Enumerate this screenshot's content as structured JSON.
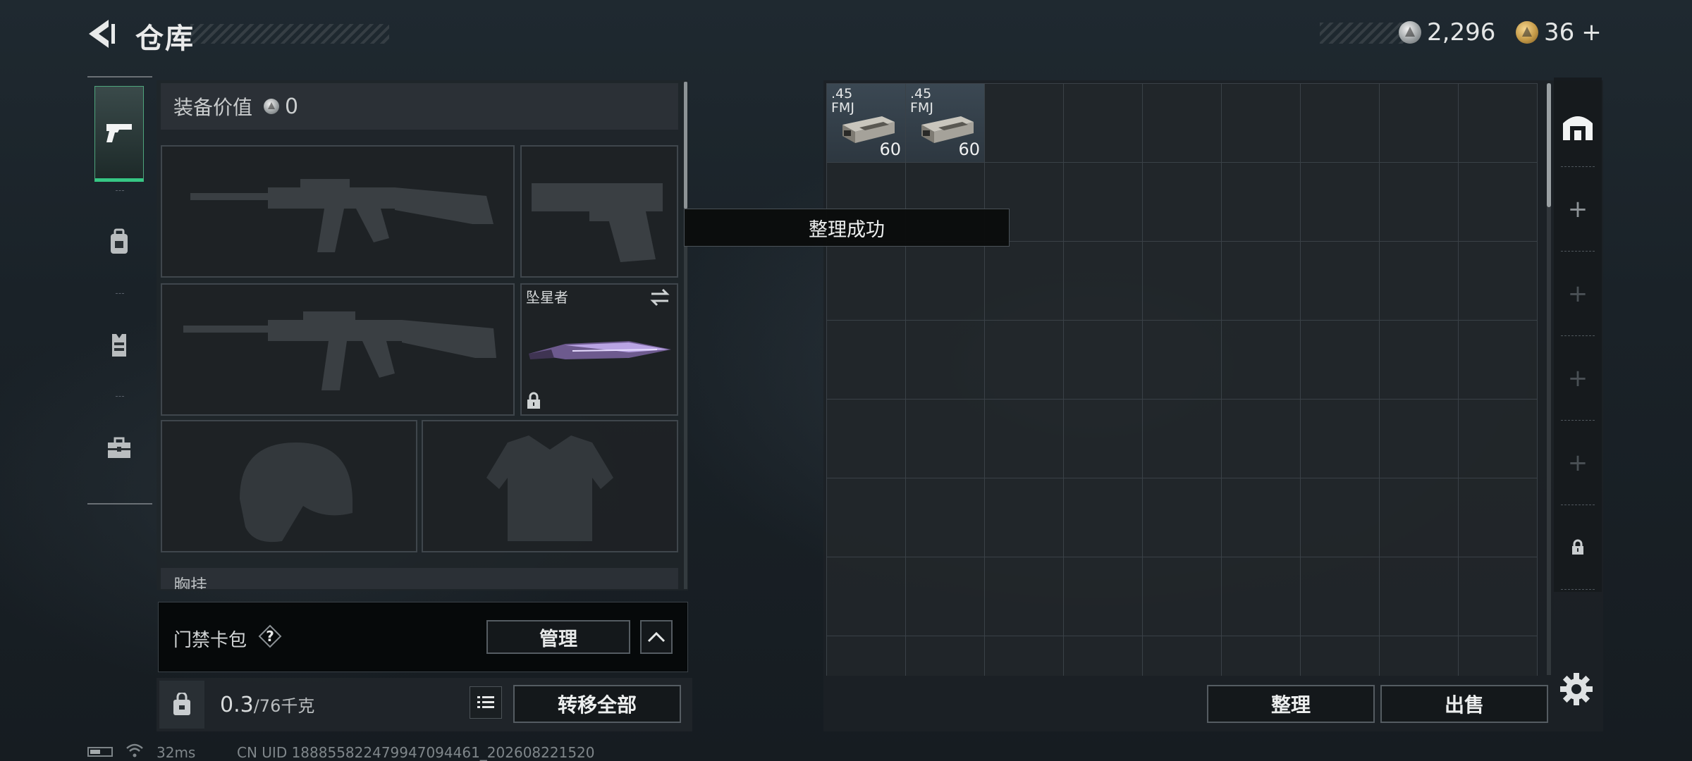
{
  "header": {
    "title": "仓库",
    "silver_amount": "2,296",
    "gold_amount": "36",
    "gold_plus": "+"
  },
  "rail": {
    "items": [
      {
        "icon": "pistol-icon",
        "active": true
      },
      {
        "icon": "backpack-icon",
        "active": false
      },
      {
        "icon": "chest-rig-icon",
        "active": false
      },
      {
        "icon": "toolbox-icon",
        "active": false
      }
    ]
  },
  "equipment": {
    "value_label": "装备价值",
    "value_amount": "0",
    "melee_name": "坠星者",
    "chest_rig_label": "胸挂"
  },
  "keycard": {
    "label": "门禁卡包",
    "manage_label": "管理"
  },
  "weight": {
    "current": "0.3",
    "capacity": "/76千克"
  },
  "buttons": {
    "transfer_all": "转移全部",
    "sort": "整理",
    "sell": "出售"
  },
  "toast": {
    "message": "整理成功"
  },
  "storage": {
    "items": [
      {
        "label_line1": ".45",
        "label_line2": "FMJ",
        "count": "60"
      },
      {
        "label_line1": ".45",
        "label_line2": "FMJ",
        "count": "60"
      }
    ]
  },
  "status": {
    "ping": "32ms",
    "uid": "CN UID 1888558224799470944​61_202608221520"
  },
  "colors": {
    "accent_green": "#36c784",
    "panel_bg": "#20262a"
  }
}
